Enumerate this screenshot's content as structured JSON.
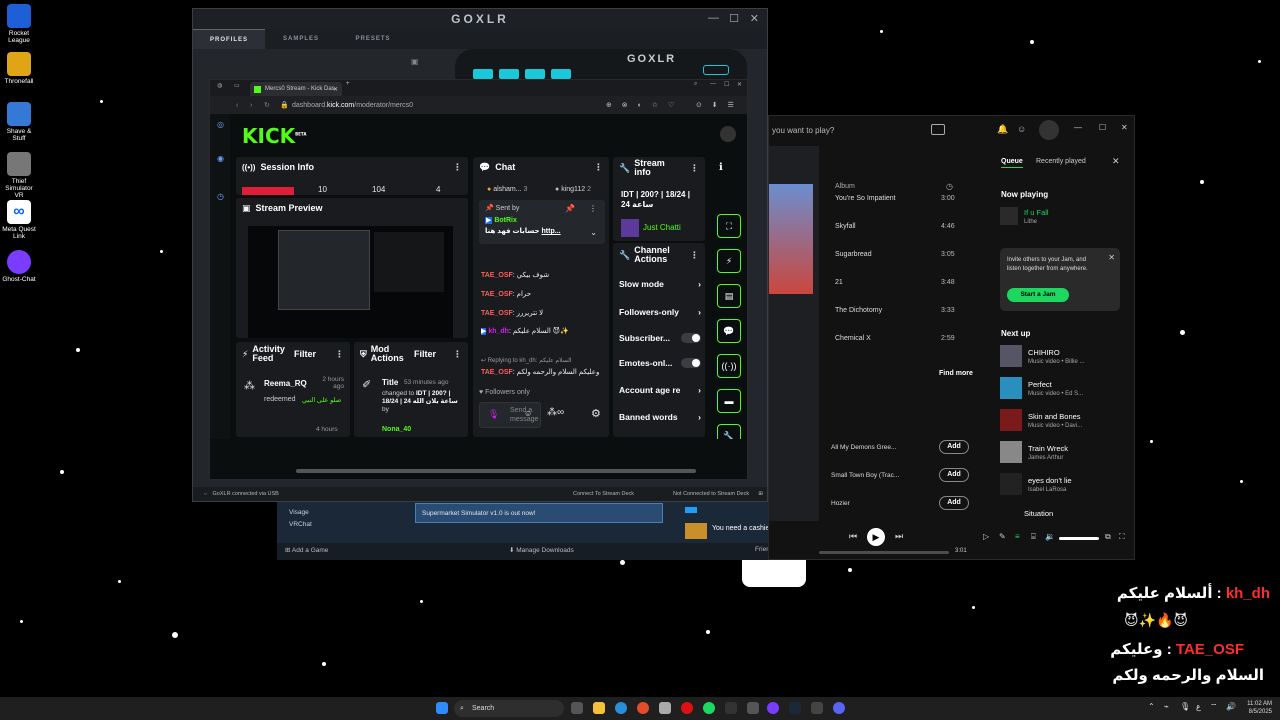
{
  "desktop_icons": [
    {
      "label": "Rocket League",
      "color": "#1f5fd6"
    },
    {
      "label": "Thronefall",
      "color": "#e0a516"
    },
    {
      "label": "Shave & Stuff",
      "color": "#3579d6"
    },
    {
      "label": "Thief Simulator VR",
      "color": "#777777"
    },
    {
      "label": "Meta Quest Link",
      "color": "#ffffff"
    },
    {
      "label": "Ghost-Chat",
      "color": "#7a3cff"
    }
  ],
  "goxlr": {
    "title": "GOXLR",
    "tabs": [
      "PROFILES",
      "SAMPLES",
      "PRESETS"
    ],
    "device_logo": "GOXLR",
    "status_left": "GoXLR connected via USB",
    "status_mid": "Connect To Stream Deck",
    "status_right": "Not Connected to Stream Deck"
  },
  "steam": {
    "items": [
      "Visage",
      "VRChat"
    ],
    "news": "Supermarket Simulator v1.0 is out now!",
    "cashier": "You need a cashier",
    "add_game": "Add a Game",
    "manage_downloads": "Manage Downloads",
    "friends_chat": "Friends & Chat"
  },
  "spotify": {
    "search_placeholder": "you want to play?",
    "col_album": "Album",
    "tracks": [
      {
        "title": "You're So Impatient",
        "duration": "3:00"
      },
      {
        "title": "Skyfall",
        "duration": "4:46"
      },
      {
        "title": "Sugarbread",
        "duration": "3:05"
      },
      {
        "title": "21",
        "duration": "3:48"
      },
      {
        "title": "The Dichotomy",
        "duration": "3:33"
      },
      {
        "title": "Chemical X",
        "duration": "2:59"
      }
    ],
    "find_more": "Find more",
    "recommend": [
      {
        "title": "All My Demons Gree..."
      },
      {
        "title": "Small Town Boy (Trac..."
      },
      {
        "title": "Hozier"
      }
    ],
    "add_label": "Add",
    "tab_queue": "Queue",
    "tab_recent": "Recently played",
    "now_playing_label": "Now playing",
    "now_playing": {
      "title": "If u Fall",
      "artist": "Lithe"
    },
    "jam_text": "Invite others to your Jam, and listen together from anywhere.",
    "jam_button": "Start a Jam",
    "next_up_label": "Next up",
    "next_up": [
      {
        "title": "CHIHIRO",
        "artist": "Music video • Billie ..."
      },
      {
        "title": "Perfect",
        "artist": "Music video • Ed S..."
      },
      {
        "title": "Skin and Bones",
        "artist": "Music video • Davi..."
      },
      {
        "title": "Train Wreck",
        "artist": "James Arthur"
      },
      {
        "title": "eyes don't lie",
        "artist": "Isabel LaRosa"
      },
      {
        "title": "Situation",
        "artist": ""
      }
    ],
    "time_elapsed": "3:01",
    "accent": "#1ed760"
  },
  "kick": {
    "tab_title": "Mercs0 Stream - Kick Das",
    "url_prefix": "dashboard.",
    "url_host": "kick.com",
    "url_path": "/moderator/mercs0",
    "logo": "KICK",
    "logo_sup": "BETA",
    "accent": "#53fc18",
    "session_info": {
      "title": "Session Info",
      "values": [
        "10",
        "104",
        "4"
      ]
    },
    "stream_preview": {
      "title": "Stream Preview"
    },
    "activity_feed": {
      "title": "Activity Feed",
      "filter": "Filter",
      "user": "Reema_RQ",
      "time": "2 hours ago",
      "action": "redeemed",
      "reward": "صلو على النبي",
      "time2": "4 hours"
    },
    "mod_actions": {
      "title": "Mod Actions",
      "filter": "Filter",
      "item": "Title",
      "time": "53 minutes ago",
      "change_prefix": "changed to",
      "change": "IDT | 200? | 18/24 | 24 ساعة بلان الله",
      "by": "by",
      "user": "Nona_40"
    },
    "chat": {
      "title": "Chat",
      "top_users": [
        {
          "name": "alsham...",
          "count": "3"
        },
        {
          "name": "king112",
          "count": "2"
        }
      ],
      "pinned_label": "Sent by",
      "pinned_user": "BotRix",
      "pinned_text": "حسابات فهد هنا",
      "pinned_link": "http...",
      "messages": [
        {
          "user": "TAE_OSF",
          "text": "شوف بيكي"
        },
        {
          "user": "TAE_OSF",
          "text": "حرام"
        },
        {
          "user": "TAE_OSF",
          "text": "لا تتريررر"
        },
        {
          "user": "kh_dh",
          "text": "السلام عليكم"
        },
        {
          "reply": "Replying to kh_dh: السلام عليكم"
        },
        {
          "user": "TAE_OSF",
          "text": "وعليكم السلام والرحمه ولكم"
        }
      ],
      "followers_only": "Followers only",
      "send_placeholder": "Send a message"
    },
    "stream_info": {
      "title": "Stream info",
      "value": "IDT | 200? | 18/24 | 24 ساعة",
      "chat_label": "Just Chatti"
    },
    "channel_actions": {
      "title": "Channel Actions",
      "items": [
        "Slow mode",
        "Followers-only",
        "Subscriber...",
        "Emotes-onl...",
        "Account age re",
        "Banned words"
      ]
    }
  },
  "overlay_chat": {
    "line1_user": "kh_dh",
    "line1_text": "ألسلام عليكم",
    "line2_user": "TAE_OSF",
    "line2_text": "وعليكم",
    "line3_text": "السلام والرحمه ولكم"
  },
  "taskbar": {
    "search": "Search",
    "lang": "ع",
    "time": "11:02 AM",
    "date": "8/5/2025"
  }
}
